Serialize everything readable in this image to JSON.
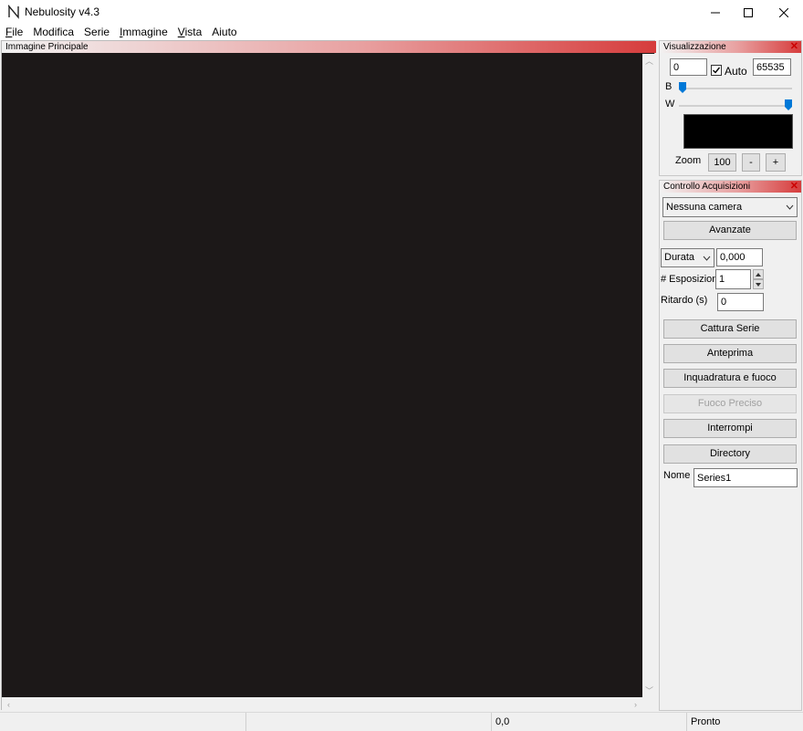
{
  "window": {
    "title": "Nebulosity v4.3",
    "minimize_glyph": "—",
    "maximize_glyph": "☐",
    "close_glyph": "✕",
    "icon": "nebulosity-logo-icon"
  },
  "menu": [
    {
      "accel": "F",
      "rest": "ile"
    },
    {
      "accel": "",
      "rest": "Modifica"
    },
    {
      "accel": "",
      "rest": "Serie"
    },
    {
      "accel": "I",
      "rest": "mmagine"
    },
    {
      "accel": "V",
      "rest": "ista"
    },
    {
      "accel": "",
      "rest": "Aiuto"
    }
  ],
  "main_pane": {
    "title": "Immagine Principale",
    "background": "#1c1818"
  },
  "display_panel": {
    "title": "Visualizzazione",
    "black_value": "0",
    "auto_label": "Auto",
    "auto_checked": true,
    "white_value": "65535",
    "b_label": "B",
    "w_label": "W",
    "b_slider_fraction": 0.0,
    "w_slider_fraction": 1.0,
    "zoom_label": "Zoom",
    "zoom_value": "100",
    "zoom_minus": "-",
    "zoom_plus": "+"
  },
  "capture_panel": {
    "title": "Controllo Acquisizioni",
    "camera_selected": "Nessuna camera",
    "advanced_button": "Avanzate",
    "duration_selected": "Durata",
    "duration_value": "0,000",
    "exposures_label": "# Esposizioni",
    "exposures_value": "1",
    "delay_label": "Ritardo (s)",
    "delay_value": "0",
    "buttons": {
      "capture_series": "Cattura Serie",
      "preview": "Anteprima",
      "frame_focus": "Inquadratura e fuoco",
      "fine_focus": "Fuoco Preciso",
      "abort": "Interrompi",
      "directory": "Directory"
    },
    "name_label": "Nome",
    "name_value": "Series1"
  },
  "status_bar": {
    "cell1": "",
    "cell2": "",
    "coords": "0,0",
    "status": "Pronto"
  },
  "colors": {
    "header_accent": "#d63c3c",
    "slider_thumb": "#0078d7"
  }
}
